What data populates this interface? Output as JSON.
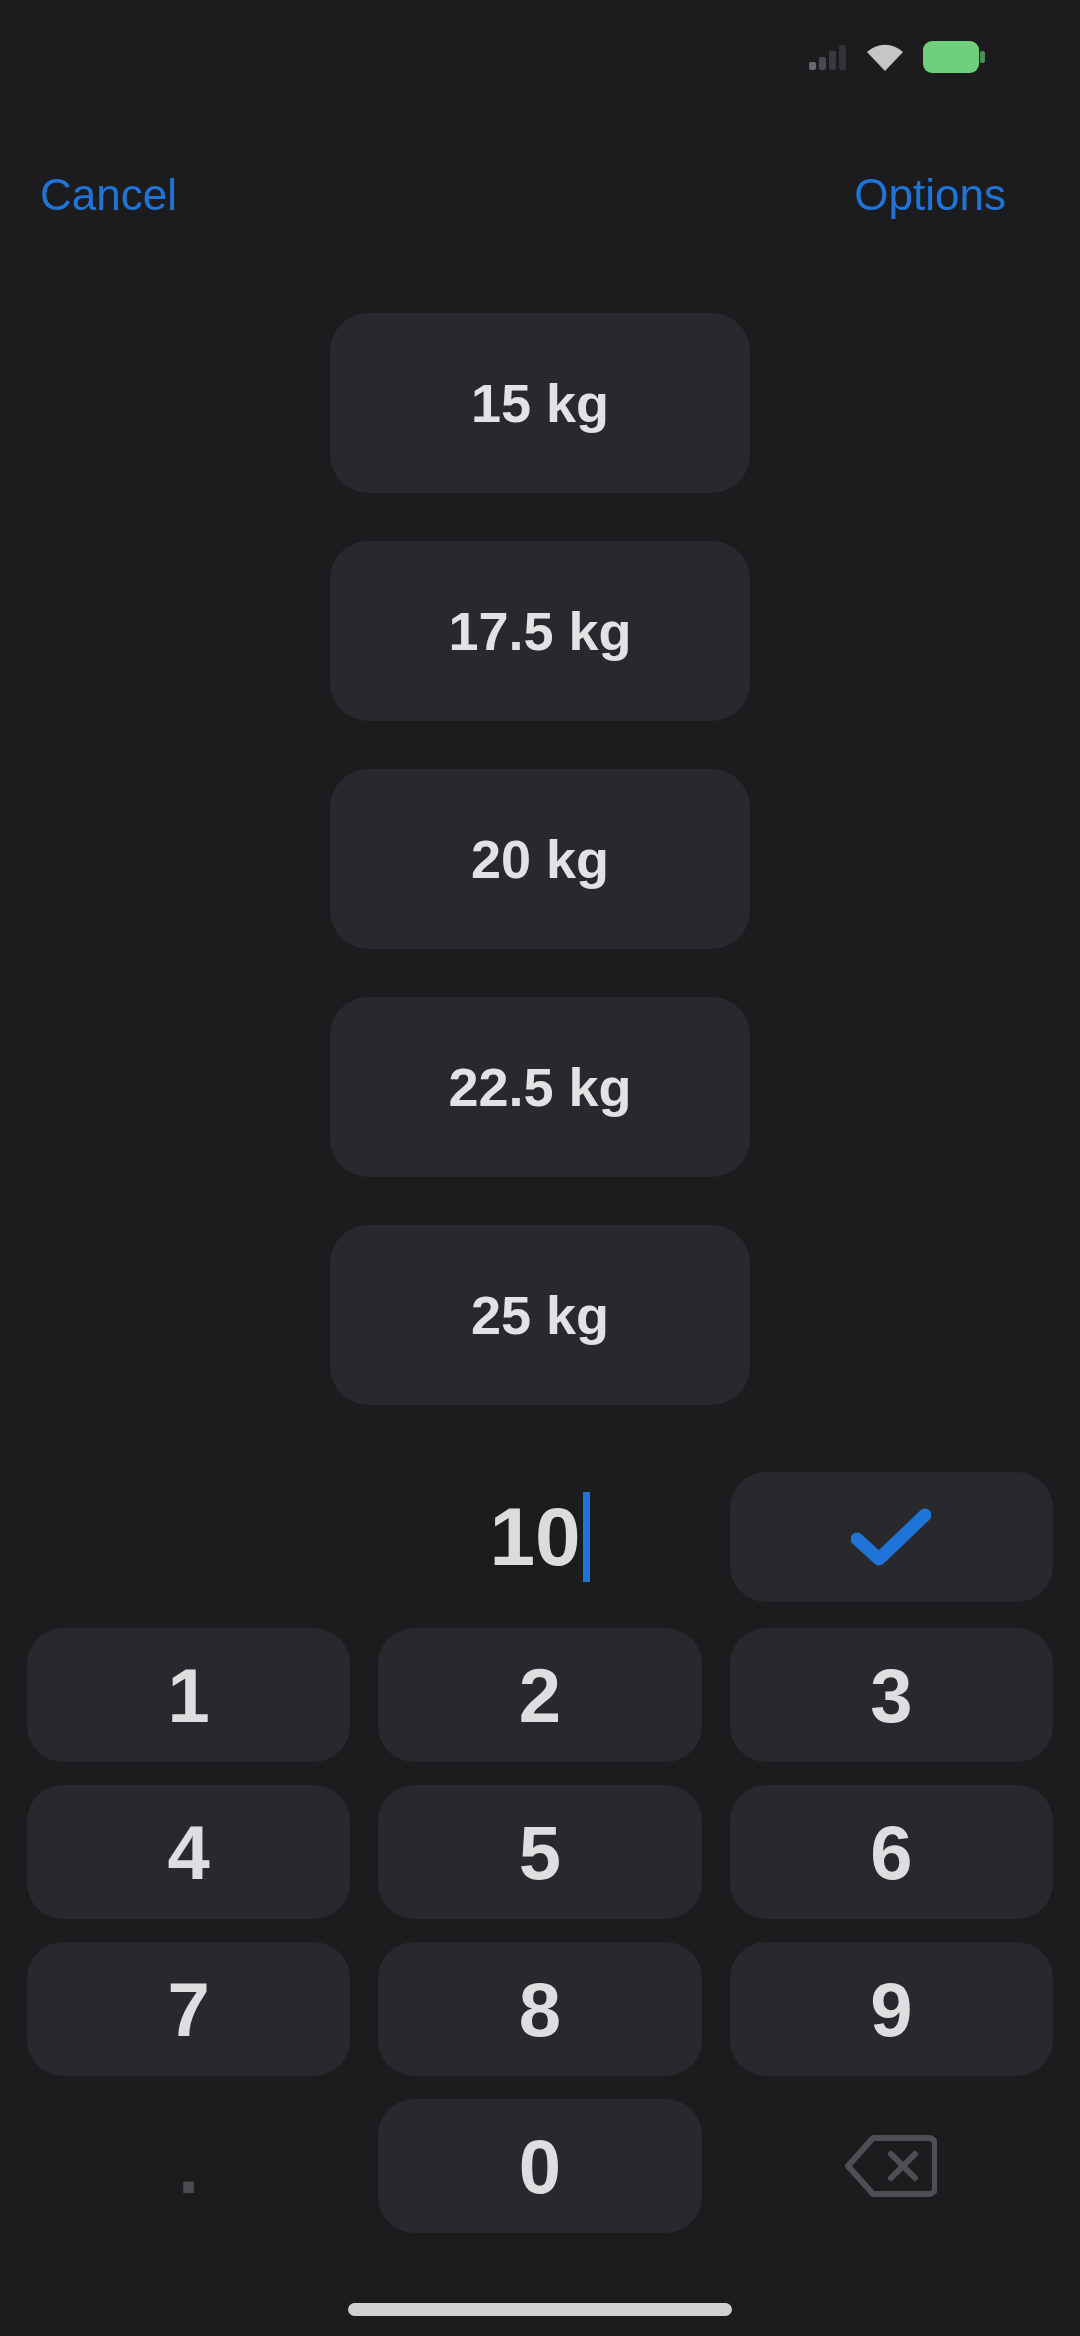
{
  "nav": {
    "cancel": "Cancel",
    "options": "Options"
  },
  "weights": [
    "15 kg",
    "17.5 kg",
    "20 kg",
    "22.5 kg",
    "25 kg"
  ],
  "entry": {
    "value": "10"
  },
  "keypad": [
    {
      "kind": "key",
      "label": "1"
    },
    {
      "kind": "key",
      "label": "2"
    },
    {
      "kind": "key",
      "label": "3"
    },
    {
      "kind": "key",
      "label": "4"
    },
    {
      "kind": "key",
      "label": "5"
    },
    {
      "kind": "key",
      "label": "6"
    },
    {
      "kind": "key",
      "label": "7"
    },
    {
      "kind": "key",
      "label": "8"
    },
    {
      "kind": "key",
      "label": "9"
    },
    {
      "kind": "bare",
      "label": "."
    },
    {
      "kind": "key",
      "label": "0"
    },
    {
      "kind": "backspace"
    }
  ]
}
